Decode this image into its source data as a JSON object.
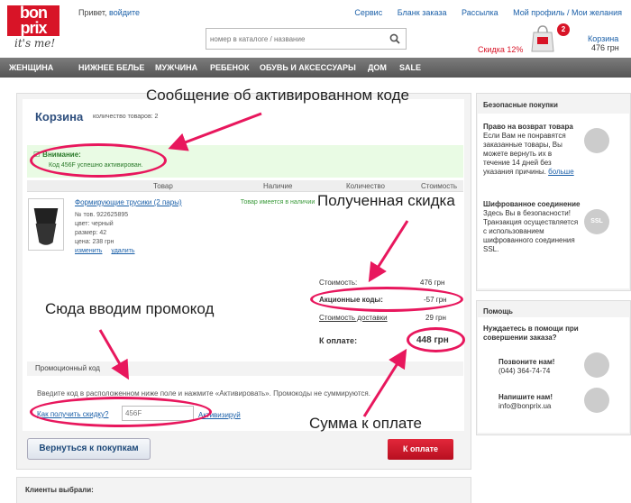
{
  "header": {
    "logo_line1": "bon",
    "logo_line2": "prix",
    "logo_tagline": "it's me!",
    "greeting_text": "Привет,",
    "login_link": "войдите",
    "top_links": [
      "Сервис",
      "Бланк заказа",
      "Рассылка",
      "Мой профиль / Мои желания"
    ],
    "search_placeholder": "номер в каталоге / название",
    "discount_text": "Скидка 12%",
    "cart_badge": "2",
    "cart_label": "Корзина",
    "cart_total": "476 грн"
  },
  "nav": {
    "items": [
      "ЖЕНЩИНА",
      "НИЖНЕЕ БЕЛЬЕ",
      "МУЖЧИНА",
      "РЕБЕНОК",
      "ОБУВЬ И АКСЕССУАРЫ",
      "ДОМ",
      "SALE"
    ]
  },
  "cart": {
    "title": "Корзина",
    "item_count": "количество товаров: 2",
    "alert_title": "Внимание:",
    "alert_message": "Код 456F успешно активирован.",
    "columns": [
      "Товар",
      "Наличие",
      "Количество",
      "Стоимость"
    ],
    "product": {
      "name": "Формирующие трусики (2 пары)",
      "info": [
        "№ тов. 922625895",
        "цвет: черный",
        "размер: 42",
        "цена: 238 грн"
      ],
      "edit_link": "изменить",
      "remove_link": "удалить",
      "availability": "Товар имеется в наличии"
    },
    "summary": {
      "cost_label": "Стоимость:",
      "cost_value": "476 грн",
      "promo_label": "Акционные коды:",
      "promo_value": "-57 грн",
      "delivery_label": "Стоимость доставки",
      "delivery_value": "29 грн",
      "total_label": "К оплате:",
      "total_value": "448 грн"
    },
    "promo": {
      "header": "Промоционный код",
      "note": "Введите код в расположенном ниже поле и нажмите «Активировать». Промокоды не суммируются.",
      "help_link": "Как получить скидку?",
      "code_value": "456F",
      "activate_link": "Активизируй"
    },
    "back_button": "Вернуться к покупкам",
    "pay_button": "К оплате",
    "clients_title": "Клиенты выбрали:"
  },
  "sidebar": {
    "safe_header": "Безопасные покупки",
    "return_title": "Право на возврат товара",
    "return_text": "Если Вам не понравятся заказанные товары, Вы можете вернуть их в течение 14 дней без указания причины.",
    "return_more": "больше",
    "ssl_title": "Шифрованное соединение",
    "ssl_text": "Здесь Вы в безопасности! Транзакция осуществляется с использованием шифрованного соединения SSL.",
    "ssl_badge": "SSL",
    "help_header": "Помощь",
    "help_text": "Нуждаетесь в помощи при совершении заказа?",
    "call_title": "Позвоните нам!",
    "call_phone": "(044) 364-74-74",
    "write_title": "Напишите нам!",
    "write_email": "info@bonprix.ua"
  },
  "annotations": {
    "code_message": "Сообщение об активированном коде",
    "discount_received": "Полученная скидка",
    "enter_promo": "Сюда вводим промокод",
    "amount_due": "Сумма к оплате"
  },
  "colors": {
    "brand_red": "#d81427",
    "annotation_pink": "#e8175d",
    "link_blue": "#1a5fa8",
    "nav_gray": "#666666"
  }
}
